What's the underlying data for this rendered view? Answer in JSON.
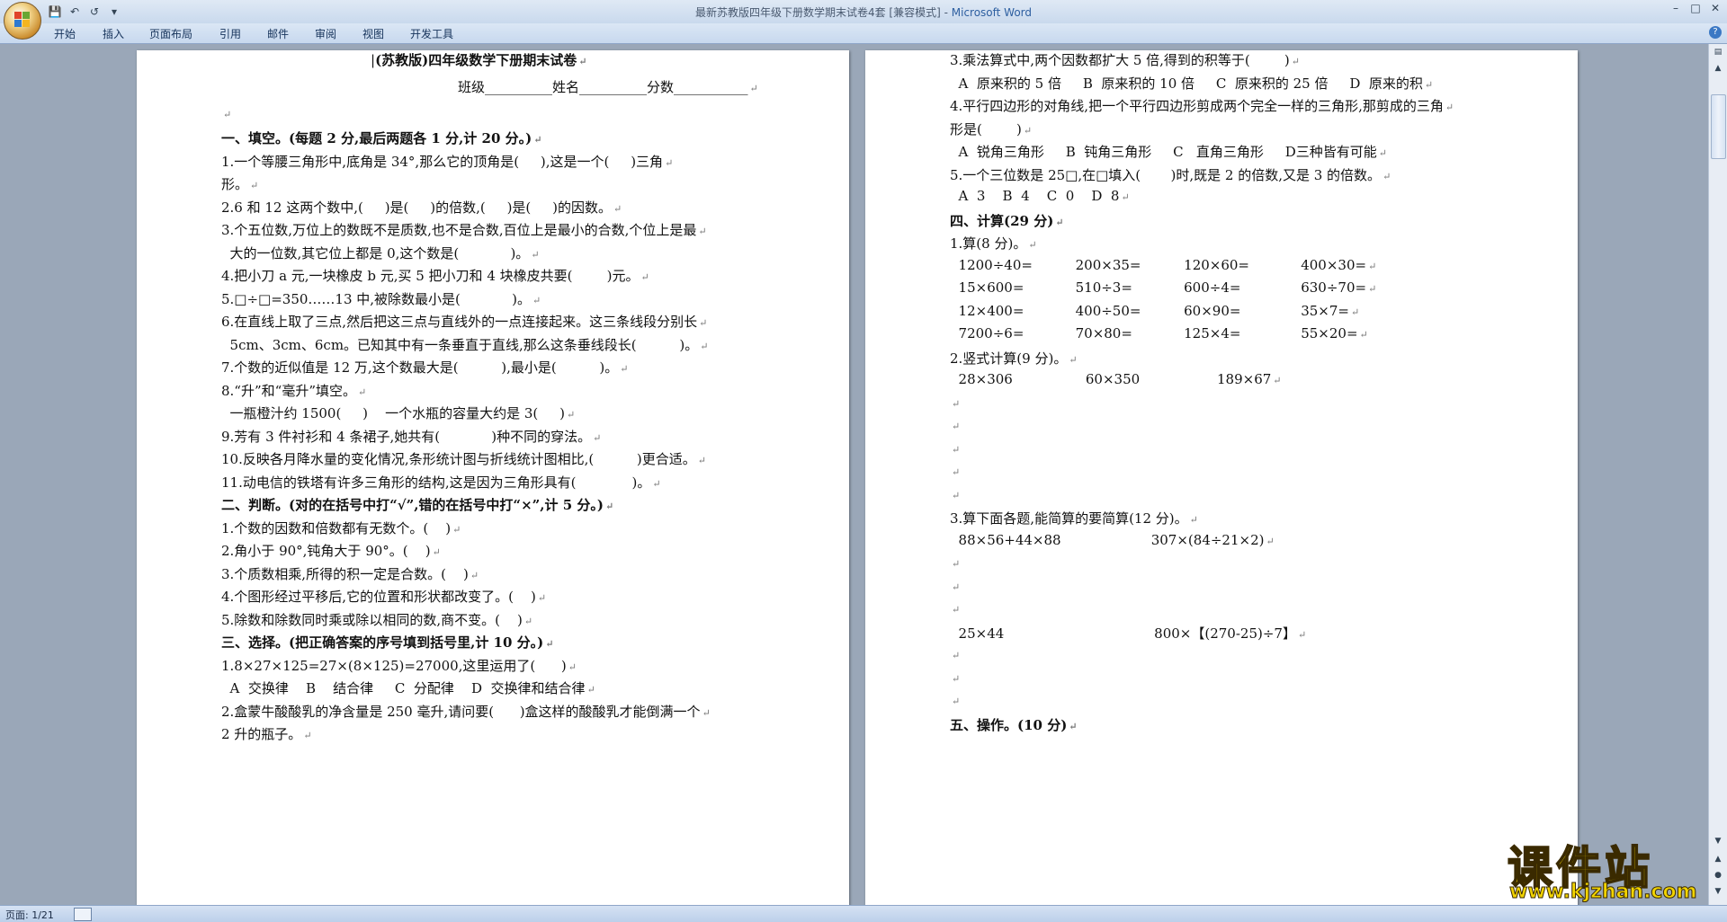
{
  "window": {
    "title": "最新苏教版四年级下册数学期末试卷4套 [兼容模式] - ",
    "app_name": "Microsoft Word"
  },
  "ribbon": {
    "tabs": [
      "开始",
      "插入",
      "页面布局",
      "引用",
      "邮件",
      "审阅",
      "视图",
      "开发工具"
    ]
  },
  "status": {
    "page": "页面: 1/21"
  },
  "watermark": {
    "text": "课件站",
    "url": "www.kjzhan.com"
  },
  "left_page": {
    "title": "(苏教版)四年级数学下册期末试卷",
    "info_line": "班级__________姓名__________分数___________",
    "lines": [
      "一、填空。(每题 2 分,最后两题各 1 分,计 20 分。)",
      "1.一个等腰三角形中,底角是 34°,那么它的顶角是(     ),这是一个(     )三角",
      "形。",
      "2.6 和 12 这两个数中,(     )是(     )的倍数,(     )是(     )的因数。",
      "3.个五位数,万位上的数既不是质数,也不是合数,百位上是最小的合数,个位上是最",
      "  大的一位数,其它位上都是 0,这个数是(            )。",
      "4.把小刀 a 元,一块橡皮 b 元,买 5 把小刀和 4 块橡皮共要(        )元。",
      "5.□÷□=350……13 中,被除数最小是(            )。",
      "6.在直线上取了三点,然后把这三点与直线外的一点连接起来。这三条线段分别长",
      "  5cm、3cm、6cm。已知其中有一条垂直于直线,那么这条垂线段长(          )。",
      "7.个数的近似值是 12 万,这个数最大是(          ),最小是(          )。",
      "8.“升”和“毫升”填空。",
      "  一瓶橙汁约 1500(     )    一个水瓶的容量大约是 3(     )",
      "9.芳有 3 件衬衫和 4 条裙子,她共有(            )种不同的穿法。",
      "10.反映各月降水量的变化情况,条形统计图与折线统计图相比,(          )更合适。",
      "11.动电信的铁塔有许多三角形的结构,这是因为三角形具有(             )。",
      "二、判断。(对的在括号中打“√”,错的在括号中打“×”,计 5 分。)",
      "1.个数的因数和倍数都有无数个。(    )",
      "2.角小于 90°,钝角大于 90°。(    )",
      "3.个质数相乘,所得的积一定是合数。(    )",
      "4.个图形经过平移后,它的位置和形状都改变了。(    )",
      "5.除数和除数同时乘或除以相同的数,商不变。(    )",
      "三、选择。(把正确答案的序号填到括号里,计 10 分。)",
      "1.8×27×125=27×(8×125)=27000,这里运用了(      )",
      "  A  交换律    B    结合律     C  分配律    D  交换律和结合律",
      "2.盒蒙牛酸酸乳的净含量是 250 毫升,请问要(      )盒这样的酸酸乳才能倒满一个",
      "2 升的瓶子。"
    ]
  },
  "right_page": {
    "lines": [
      "3.乘法算式中,两个因数都扩大 5 倍,得到的积等于(        )",
      "  A  原来积的 5 倍     B  原来积的 10 倍     C  原来积的 25 倍     D  原来的积",
      "4.平行四边形的对角线,把一个平行四边形剪成两个完全一样的三角形,那剪成的三角",
      "形是(        )",
      "  A  锐角三角形     B  钝角三角形     C   直角三角形     D三种皆有可能",
      "5.一个三位数是 25□,在□填入(       )时,既是 2 的倍数,又是 3 的倍数。",
      "  A  3    B  4    C  0    D  8",
      "四、计算(29 分)",
      "1.算(8 分)。",
      "  1200÷40=          200×35=          120×60=            400×30=",
      "  15×600=            510÷3=            600÷4=              630÷70=",
      "  12×400=            400÷50=          60×90=              35×7=",
      "  7200÷6=            70×80=            125×4=              55×20=",
      "2.竖式计算(9 分)。",
      "  28×306                 60×350                  189×67",
      "",
      "",
      "",
      "",
      "",
      "3.算下面各题,能简算的要简算(12 分)。",
      "  88×56+44×88                     307×(84÷21×2)",
      "",
      "",
      "",
      "  25×44                                   800×【(270-25)÷7】",
      "",
      "",
      "",
      "五、操作。(10 分)"
    ]
  }
}
